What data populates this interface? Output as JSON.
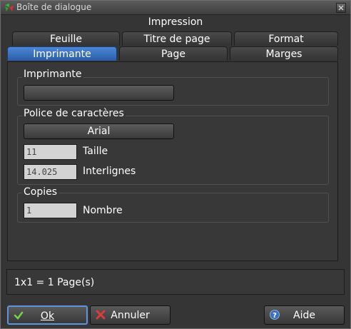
{
  "window": {
    "title": "Boîte de dialogue"
  },
  "dialog": {
    "heading": "Impression"
  },
  "tabs_back": [
    "Feuille",
    "Titre de page",
    "Format"
  ],
  "tabs_front": [
    "Imprimante",
    "Page",
    "Marges"
  ],
  "active_tab": "Imprimante",
  "printer": {
    "legend": "Imprimante",
    "button_label": ""
  },
  "font": {
    "legend": "Police de caractères",
    "button_label": "Arial",
    "size_value": "11",
    "size_label": "Taille",
    "line_value": "14.025",
    "line_label": "Interlignes"
  },
  "copies": {
    "legend": "Copies",
    "count_value": "1",
    "count_label": "Nombre"
  },
  "status": {
    "text": "1x1 = 1 Page(s)"
  },
  "buttons": {
    "ok": {
      "label": "Ok",
      "icon": "check-icon"
    },
    "cancel": {
      "label": "Annuler",
      "icon": "cross-icon"
    },
    "help": {
      "label": "Aide",
      "icon": "help-icon"
    }
  },
  "colors": {
    "accent": "#3a6fc0",
    "background": "#353535",
    "focus": "#5b95e0"
  }
}
